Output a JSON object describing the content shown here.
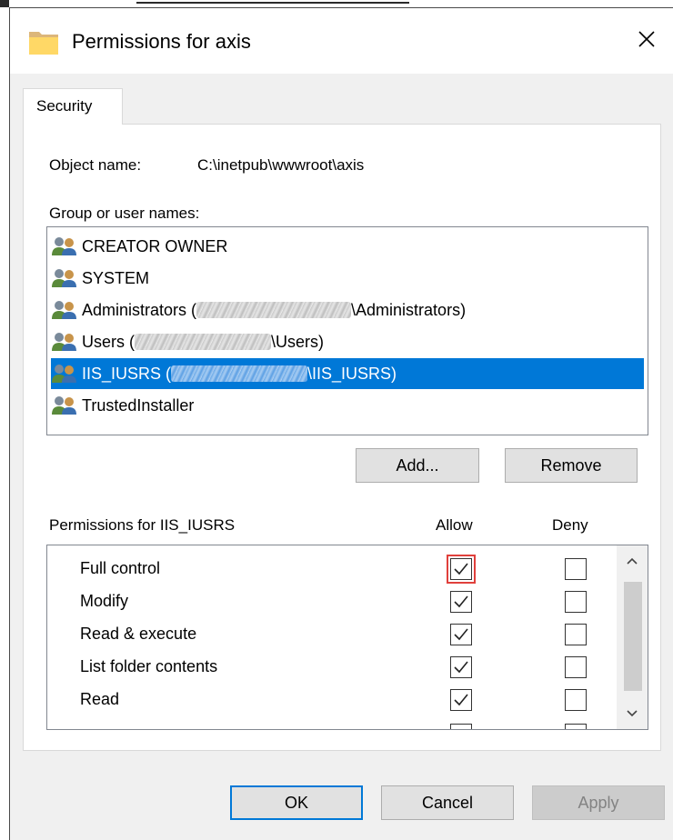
{
  "window": {
    "title": "Permissions for axis"
  },
  "tabs": [
    {
      "label": "Security"
    }
  ],
  "object": {
    "label": "Object name:",
    "value": "C:\\inetpub\\wwwroot\\axis"
  },
  "groups": {
    "label": "Group or user names:",
    "items": [
      {
        "prefix": "CREATOR OWNER",
        "suffix": "",
        "redacted": false,
        "selected": false
      },
      {
        "prefix": "SYSTEM",
        "suffix": "",
        "redacted": false,
        "selected": false
      },
      {
        "prefix": "Administrators (",
        "suffix": "\\Administrators)",
        "redacted": true,
        "selected": false
      },
      {
        "prefix": "Users (",
        "suffix": "\\Users)",
        "redacted": true,
        "selected": false
      },
      {
        "prefix": "IIS_IUSRS (",
        "suffix": "\\IIS_IUSRS)",
        "redacted": true,
        "selected": true
      },
      {
        "prefix": "TrustedInstaller",
        "suffix": "",
        "redacted": false,
        "selected": false
      }
    ],
    "icon": "users-icon",
    "selected_color": "#0078d7"
  },
  "buttons": {
    "add": "Add...",
    "remove": "Remove",
    "ok": "OK",
    "cancel": "Cancel",
    "apply": "Apply"
  },
  "permissions": {
    "label": "Permissions for IIS_IUSRS",
    "allow_header": "Allow",
    "deny_header": "Deny",
    "rows": [
      {
        "name": "Full control",
        "allow": true,
        "deny": false
      },
      {
        "name": "Modify",
        "allow": true,
        "deny": false
      },
      {
        "name": "Read & execute",
        "allow": true,
        "deny": false
      },
      {
        "name": "List folder contents",
        "allow": true,
        "deny": false
      },
      {
        "name": "Read",
        "allow": true,
        "deny": false
      }
    ]
  }
}
